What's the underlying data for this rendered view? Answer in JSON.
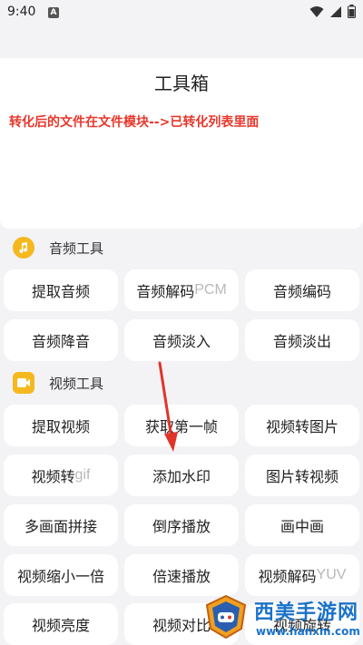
{
  "status_bar": {
    "time": "9:40",
    "notification_badge": "A"
  },
  "header": {
    "title": "工具箱"
  },
  "notice": {
    "text": "转化后的文件在文件模块-->已转化列表里面"
  },
  "audio_section": {
    "label": "音频工具",
    "icon": "music-note-icon",
    "buttons": [
      {
        "label": "提取音频",
        "suffix": ""
      },
      {
        "label": "音频解码",
        "suffix": "PCM"
      },
      {
        "label": "音频编码",
        "suffix": ""
      },
      {
        "label": "音频降音",
        "suffix": ""
      },
      {
        "label": "音频淡入",
        "suffix": ""
      },
      {
        "label": "音频淡出",
        "suffix": ""
      }
    ]
  },
  "video_section": {
    "label": "视频工具",
    "icon": "video-play-icon",
    "buttons": [
      {
        "label": "提取视频",
        "suffix": ""
      },
      {
        "label": "获取第一帧",
        "suffix": ""
      },
      {
        "label": "视频转图片",
        "suffix": ""
      },
      {
        "label": "视频转",
        "suffix": "gif"
      },
      {
        "label": "添加水印",
        "suffix": ""
      },
      {
        "label": "图片转视频",
        "suffix": ""
      },
      {
        "label": "多画面拼接",
        "suffix": ""
      },
      {
        "label": "倒序播放",
        "suffix": ""
      },
      {
        "label": "画中画",
        "suffix": ""
      },
      {
        "label": "视频缩小一倍",
        "suffix": ""
      },
      {
        "label": "倍速播放",
        "suffix": ""
      },
      {
        "label": "视频解码",
        "suffix": "YUV"
      },
      {
        "label": "视频亮度",
        "suffix": ""
      },
      {
        "label": "视频对比",
        "suffix": ""
      },
      {
        "label": "视频旋转",
        "suffix": ""
      }
    ]
  },
  "watermark": {
    "title": "西美手游网",
    "url": "www.hanxm.com"
  },
  "colors": {
    "accent": "#f5b81e",
    "notice": "#e8372c",
    "watermark": "#1a72c8",
    "arrow": "#e0342a"
  }
}
